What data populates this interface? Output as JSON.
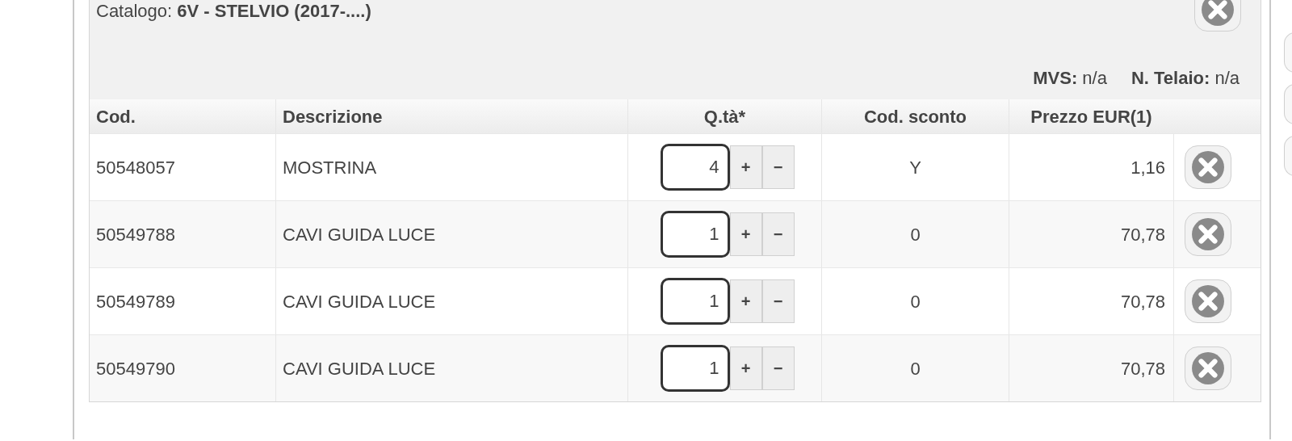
{
  "catalog": "Catalogo: **6V - STELVIO (2017-....)**",
  "vehicle_info": [
    "**MVS:** n/a",
    "**N. Telaio:** n/a"
  ],
  "table": {
    "columns": [
      "Cod.",
      "Descrizione",
      "Q.tà*",
      "Cod. sconto",
      "Prezzo EUR(1)"
    ],
    "rows": [
      {
        "cod": "50548057",
        "descrizione": "MOSTRINA",
        "qty": "4",
        "sconto": "Y",
        "prezzo": "1,16"
      },
      {
        "cod": "50549788",
        "descrizione": "CAVI GUIDA LUCE",
        "qty": "1",
        "sconto": "0",
        "prezzo": "70,78"
      },
      {
        "cod": "50549789",
        "descrizione": "CAVI GUIDA LUCE",
        "qty": "1",
        "sconto": "0",
        "prezzo": "70,78"
      },
      {
        "cod": "50549790",
        "descrizione": "CAVI GUIDA LUCE",
        "qty": "1",
        "sconto": "0",
        "prezzo": "70,78"
      }
    ]
  },
  "qty_buttons": [
    "+",
    "−"
  ]
}
